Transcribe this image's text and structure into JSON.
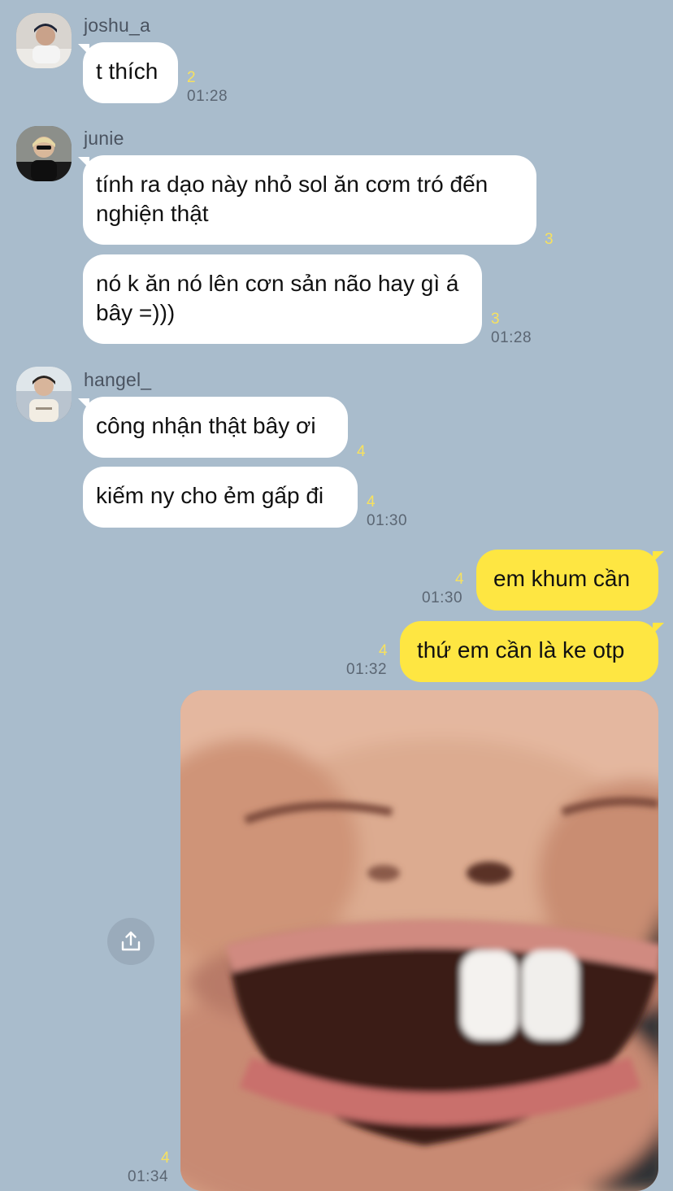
{
  "messages": [
    {
      "sender": "joshu_a",
      "bubbles": [
        {
          "text": "t thích",
          "unread": "2",
          "time": "01:28"
        }
      ]
    },
    {
      "sender": "junie",
      "bubbles": [
        {
          "text": "tính ra dạo này nhỏ sol ăn cơm tró đến nghiện thật",
          "unread": "3"
        },
        {
          "text": "nó k ăn nó lên cơn sản não hay gì á bây =)))",
          "unread": "3",
          "time": "01:28"
        }
      ]
    },
    {
      "sender": "hangel_",
      "bubbles": [
        {
          "text": "công nhận thật bây ơi",
          "unread": "4"
        },
        {
          "text": "kiếm ny cho ẻm gấp đi",
          "unread": "4",
          "time": "01:30"
        }
      ]
    }
  ],
  "outgoing": [
    {
      "text": "em khum cần",
      "unread": "4",
      "time": "01:30"
    },
    {
      "text": "thứ em cần là ke otp",
      "unread": "4",
      "time": "01:32"
    }
  ],
  "photo_message": {
    "unread": "4",
    "time": "01:34",
    "description_icon": "share-icon"
  },
  "colors": {
    "background": "#a9bccc",
    "incoming_bubble": "#ffffff",
    "outgoing_bubble": "#fee642",
    "unread_count": "#f7e15e",
    "time": "#5b6673"
  }
}
